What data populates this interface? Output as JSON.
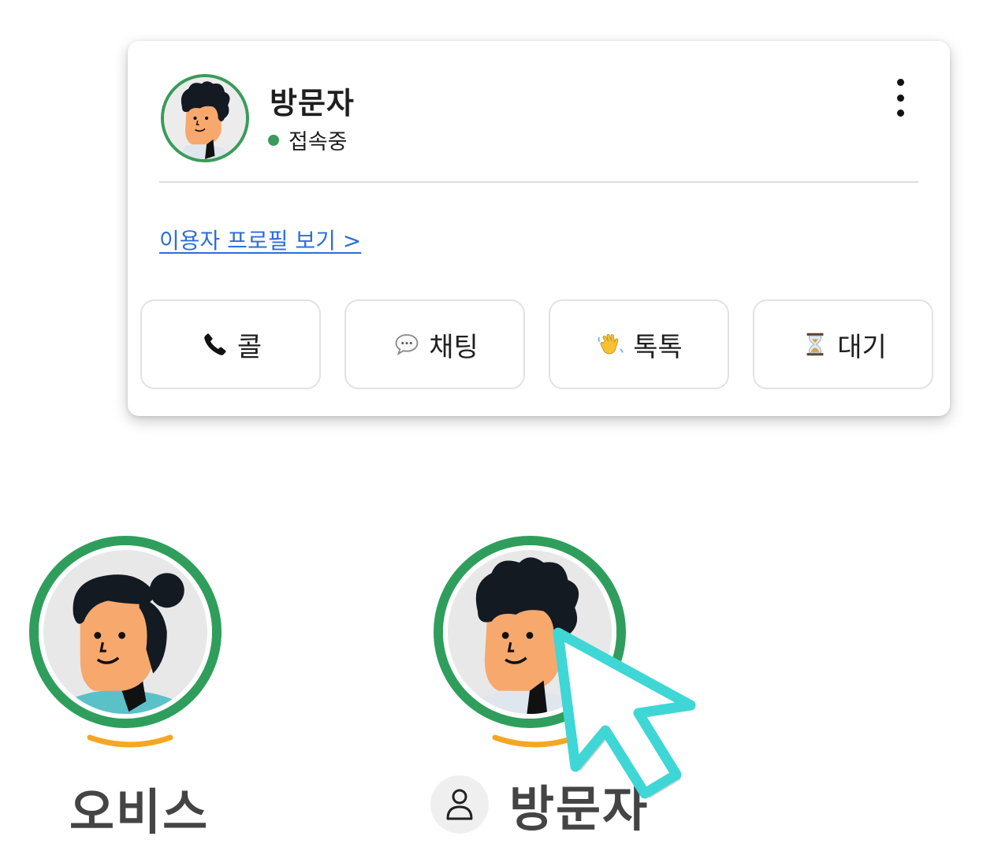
{
  "card": {
    "name": "방문자",
    "status": "접속중",
    "profile_link": "이용자 프로필 보기 >",
    "actions": [
      {
        "icon": "phone-icon",
        "label": "콜"
      },
      {
        "icon": "speech-bubble-icon",
        "label": "채팅"
      },
      {
        "icon": "waving-hand-icon",
        "label": "톡톡"
      },
      {
        "icon": "hourglass-icon",
        "label": "대기"
      }
    ]
  },
  "users": [
    {
      "name": "오비스"
    },
    {
      "name": "방문자"
    }
  ],
  "colors": {
    "status_green": "#3a9b5a",
    "ring_green": "#2f9e5c",
    "link_blue": "#2d6ed6",
    "arc_orange": "#f5a623",
    "cursor_teal": "#3fd6d6"
  }
}
